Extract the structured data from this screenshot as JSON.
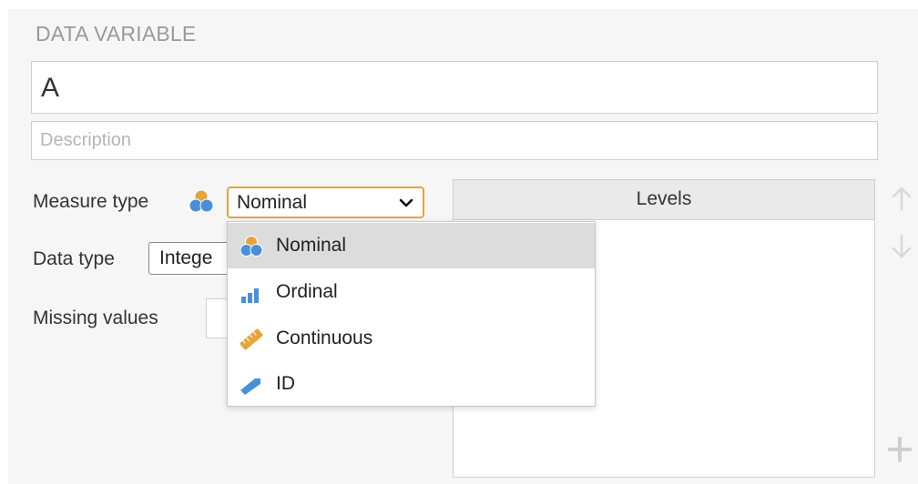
{
  "section_title": "DATA VARIABLE",
  "variable": {
    "name": "A",
    "description_placeholder": "Description"
  },
  "measure_type": {
    "label": "Measure type",
    "selected": "Nominal",
    "icon": "nominal-icon"
  },
  "data_type": {
    "label": "Data type",
    "selected": "Intege"
  },
  "missing_values": {
    "label": "Missing values"
  },
  "levels": {
    "header": "Levels"
  },
  "dropdown": {
    "options": [
      {
        "label": "Nominal",
        "icon": "nominal-icon",
        "selected": true
      },
      {
        "label": "Ordinal",
        "icon": "ordinal-icon",
        "selected": false
      },
      {
        "label": "Continuous",
        "icon": "continuous-icon",
        "selected": false
      },
      {
        "label": "ID",
        "icon": "id-icon",
        "selected": false
      }
    ]
  },
  "colors": {
    "accent_orange": "#e8a33b",
    "icon_blue": "#4a90d9",
    "panel_bg": "#f6f6f6",
    "selected_option_bg": "#dcdcdc"
  }
}
